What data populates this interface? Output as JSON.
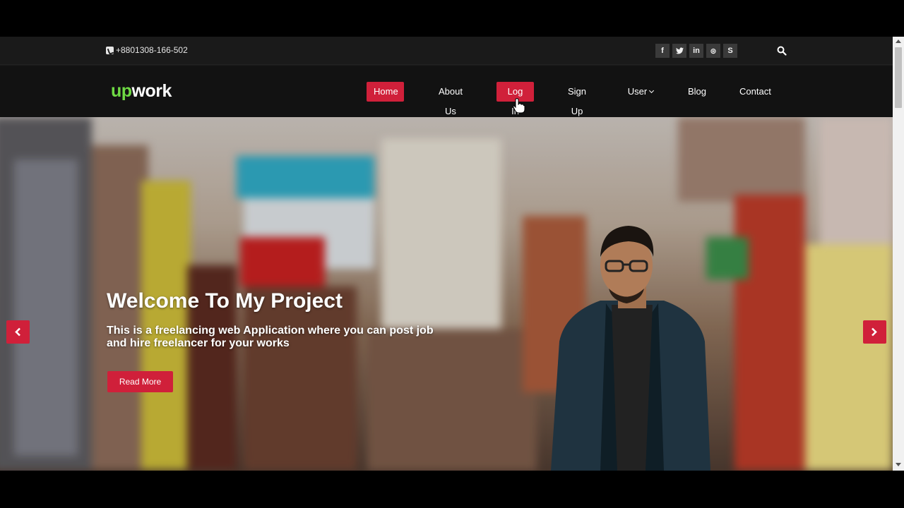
{
  "topbar": {
    "phone": "+8801308-166-502",
    "socials": [
      {
        "icon": "facebook-icon",
        "glyph": "f"
      },
      {
        "icon": "twitter-icon",
        "glyph": "t"
      },
      {
        "icon": "linkedin-icon",
        "glyph": "in"
      },
      {
        "icon": "dribbble-icon",
        "glyph": "⊛"
      },
      {
        "icon": "skype-icon",
        "glyph": "S"
      }
    ]
  },
  "brand": {
    "prefix": "up",
    "suffix": "work",
    "prefix_color": "#6fda44"
  },
  "nav": {
    "items": [
      {
        "label": "Home",
        "active": true
      },
      {
        "label": "About Us",
        "active": false
      },
      {
        "label": "Log In",
        "active": true
      },
      {
        "label": "Sign Up",
        "active": false
      },
      {
        "label": "User",
        "active": false,
        "dropdown": true
      },
      {
        "label": "Blog",
        "active": false
      },
      {
        "label": "Contact",
        "active": false
      }
    ]
  },
  "hero": {
    "title": "Welcome To My Project",
    "description": "This is a freelancing web Application where you can post job and hire freelancer for your works",
    "button": "Read More"
  },
  "colors": {
    "accent": "#d0203a",
    "topbar_bg": "#1a1a1a",
    "nav_bg": "#121212"
  }
}
